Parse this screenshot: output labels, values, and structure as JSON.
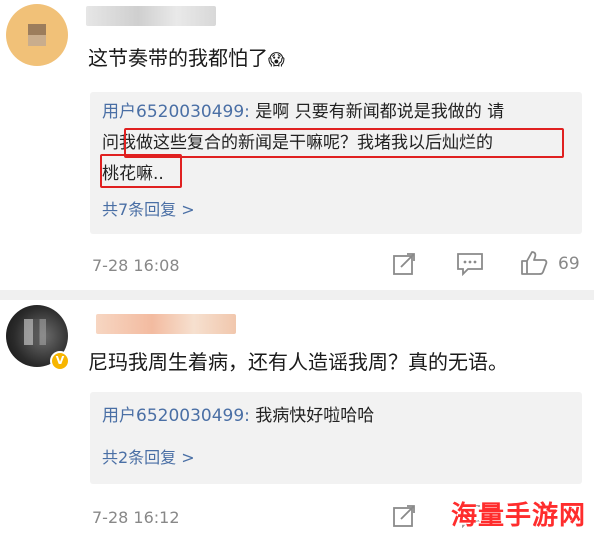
{
  "comments": [
    {
      "text": "这节奏带的我都怕了",
      "emoji": "😱",
      "reply": {
        "user": "用户6520030499:",
        "line1": " 是啊 只要有新闻都说是我做的 请",
        "line2a": "问",
        "line2b": "我做这些复合的新闻是干嘛呢？我堵我以后灿烂的",
        "line3": "桃花嘛..",
        "more": "共7条回复 >"
      },
      "time": "7-28 16:08",
      "likes": "69"
    },
    {
      "text": "尼玛我周生着病，还有人造谣我周？真的无语。",
      "reply": {
        "user": "用户6520030499:",
        "line1": " 我病快好啦哈哈",
        "more": "共2条回复 >"
      },
      "time": "7-28 16:12"
    }
  ],
  "badge": "V",
  "watermark": "海量手游网",
  "colors": {
    "link": "#4a6fa5",
    "highlight": "#e02020",
    "reply_bg": "#f2f2f2"
  }
}
